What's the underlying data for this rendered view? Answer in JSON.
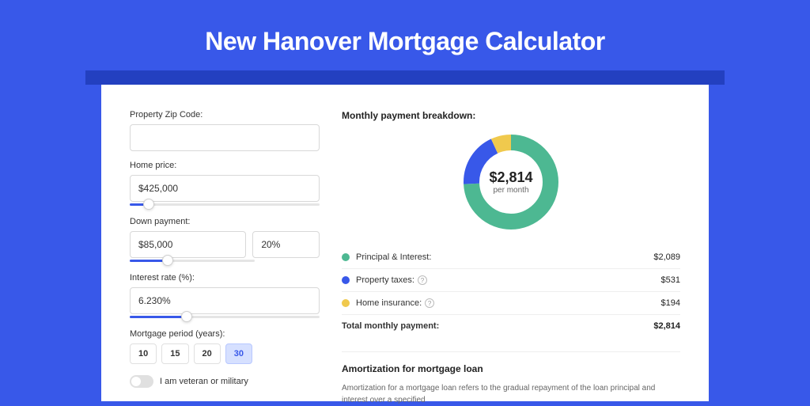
{
  "header": {
    "title": "New Hanover Mortgage Calculator"
  },
  "form": {
    "zip_label": "Property Zip Code:",
    "zip_value": "",
    "home_price_label": "Home price:",
    "home_price_value": "$425,000",
    "home_price_slider_pct": 10,
    "down_payment_label": "Down payment:",
    "down_payment_value": "$85,000",
    "down_payment_pct": "20%",
    "down_payment_slider_pct": 30,
    "interest_label": "Interest rate (%):",
    "interest_value": "6.230%",
    "interest_slider_pct": 30,
    "period_label": "Mortgage period (years):",
    "periods": [
      "10",
      "15",
      "20",
      "30"
    ],
    "period_active": "30",
    "veteran_label": "I am veteran or military"
  },
  "breakdown": {
    "title": "Monthly payment breakdown:",
    "total_display": "$2,814",
    "total_sub": "per month",
    "rows": [
      {
        "label": "Principal & Interest:",
        "value": "$2,089"
      },
      {
        "label": "Property taxes:",
        "value": "$531"
      },
      {
        "label": "Home insurance:",
        "value": "$194"
      }
    ],
    "total_label": "Total monthly payment:",
    "total_value": "$2,814"
  },
  "amortization": {
    "title": "Amortization for mortgage loan",
    "text": "Amortization for a mortgage loan refers to the gradual repayment of the loan principal and interest over a specified"
  },
  "chart_data": {
    "type": "pie",
    "title": "Monthly payment breakdown",
    "series": [
      {
        "name": "Principal & Interest",
        "value": 2089,
        "color": "#4db892"
      },
      {
        "name": "Property taxes",
        "value": 531,
        "color": "#3858e9"
      },
      {
        "name": "Home insurance",
        "value": 194,
        "color": "#f0c94d"
      }
    ],
    "total": 2814
  }
}
